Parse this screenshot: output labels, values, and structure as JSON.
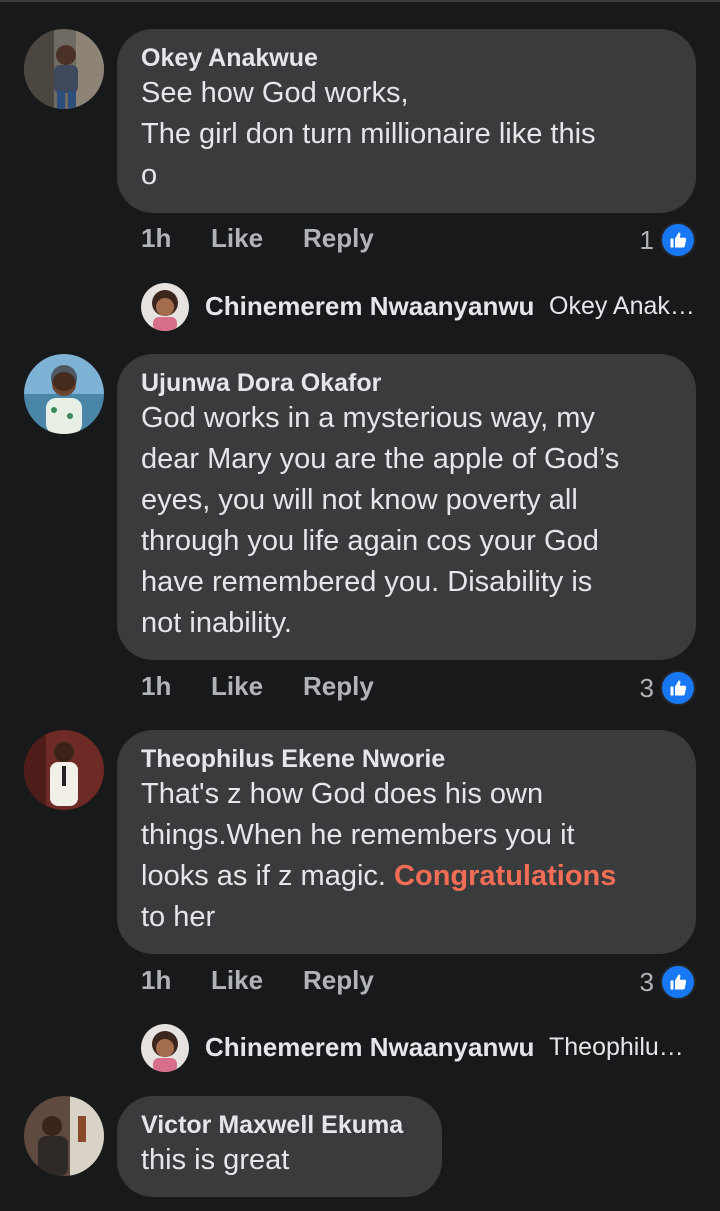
{
  "comments": [
    {
      "author": "Okey Anakwue",
      "lines": [
        "See how God works,",
        "The girl don turn millionaire like this",
        "o"
      ],
      "time": "1h",
      "like": "Like",
      "reply": "Reply",
      "reactions": "1",
      "reply_preview": {
        "name": "Chinemerem Nwaanyanwu",
        "text": "Okey Anak…"
      }
    },
    {
      "author": "Ujunwa Dora Okafor",
      "lines": [
        "God works in a mysterious way, my",
        "dear Mary you are the apple of God’s",
        "eyes, you will not know poverty all",
        "through you life again cos your God",
        "have remembered you. Disability is",
        "not inability."
      ],
      "time": "1h",
      "like": "Like",
      "reply": "Reply",
      "reactions": "3"
    },
    {
      "author": "Theophilus Ekene Nworie",
      "lines": [
        "That's z how God does his own",
        "things.When he remembers you it"
      ],
      "line3_prefix": "looks as if z magic.",
      "highlight": "Congratulations",
      "line4": "to her",
      "time": "1h",
      "like": "Like",
      "reply": "Reply",
      "reactions": "3",
      "reply_preview": {
        "name": "Chinemerem Nwaanyanwu",
        "text": "Theophilu…"
      }
    },
    {
      "author": "Victor Maxwell Ekuma",
      "lines": [
        "this is great"
      ]
    }
  ],
  "colors": {
    "background": "#18191a",
    "bubble": "#3a3b3c",
    "secondary_text": "#b0b3b8",
    "like_blue": "#1877f2",
    "highlight": "#f26d56"
  },
  "icons": [
    "avatar",
    "like-reaction-icon"
  ]
}
